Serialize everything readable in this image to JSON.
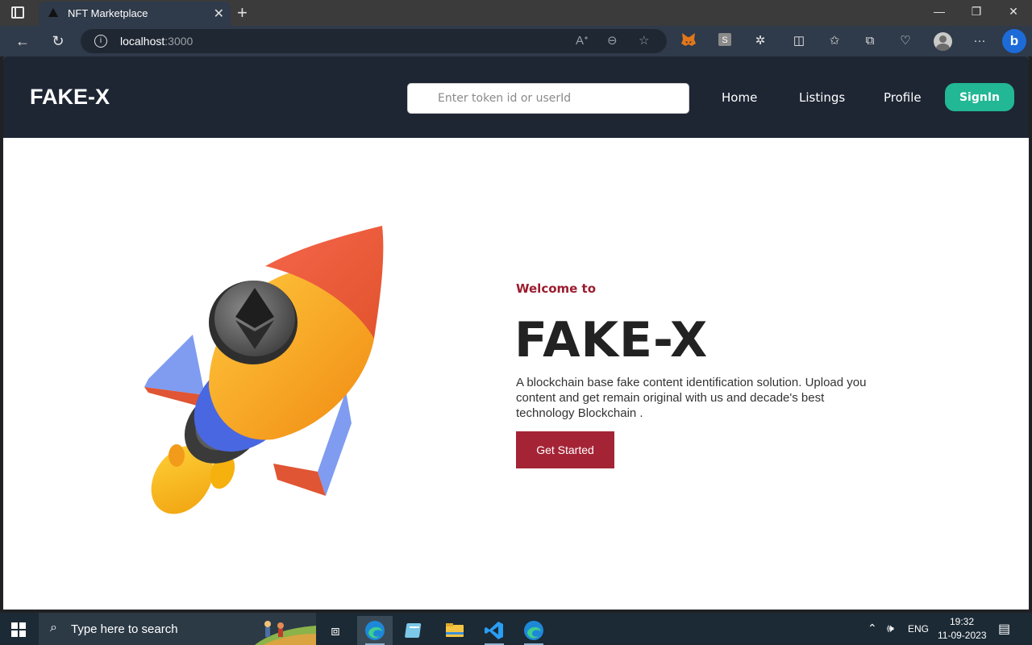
{
  "browser": {
    "tab_title": "NFT Marketplace",
    "url_host": "localhost",
    "url_port": ":3000"
  },
  "site": {
    "brand": "FAKE-X",
    "search_placeholder": "Enter token id or userId",
    "nav": {
      "home": "Home",
      "listings": "Listings",
      "profile": "Profile",
      "signin": "SignIn"
    },
    "hero": {
      "welcome": "Welcome to",
      "title": "FAKE-X",
      "description": "A blockchain base fake content identification solution. Upload you content and get remain original with us and decade's best technology Blockchain .",
      "cta": "Get Started"
    },
    "colors": {
      "navbar": "#1e2634",
      "accent_teal": "#22b795",
      "accent_red": "#a42436"
    }
  },
  "taskbar": {
    "search_text": "Type here to search",
    "language": "ENG",
    "time": "19:32",
    "date": "11-09-2023"
  }
}
